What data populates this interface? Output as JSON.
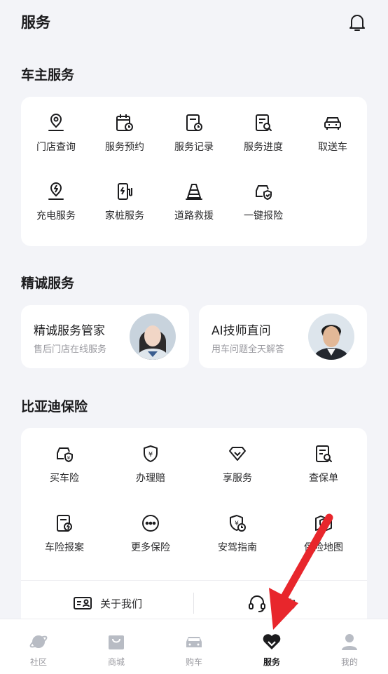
{
  "header": {
    "title": "服务",
    "bell_icon": "bell-icon"
  },
  "owner_services": {
    "title": "车主服务",
    "items": [
      {
        "label": "门店查询",
        "icon": "location-pin-icon"
      },
      {
        "label": "服务预约",
        "icon": "calendar-clock-icon"
      },
      {
        "label": "服务记录",
        "icon": "document-clock-icon"
      },
      {
        "label": "服务进度",
        "icon": "document-search-icon"
      },
      {
        "label": "取送车",
        "icon": "car-front-icon"
      },
      {
        "label": "充电服务",
        "icon": "charging-pin-icon"
      },
      {
        "label": "家桩服务",
        "icon": "charging-pile-icon"
      },
      {
        "label": "道路救援",
        "icon": "traffic-cone-icon"
      },
      {
        "label": "一键报险",
        "icon": "car-shield-icon"
      }
    ]
  },
  "sincere_services": {
    "title": "精诚服务",
    "cards": [
      {
        "title": "精诚服务管家",
        "subtitle": "售后门店在线服务",
        "avatar": "female-advisor-avatar"
      },
      {
        "title": "AI技师直问",
        "subtitle": "用车问题全天解答",
        "avatar": "male-technician-avatar"
      }
    ]
  },
  "insurance": {
    "title": "比亚迪保险",
    "items": [
      {
        "label": "买车险",
        "icon": "car-shield-yuan-icon"
      },
      {
        "label": "办理赔",
        "icon": "shield-yuan-icon"
      },
      {
        "label": "享服务",
        "icon": "diamond-icon"
      },
      {
        "label": "查保单",
        "icon": "policy-search-icon"
      },
      {
        "label": "车险报案",
        "icon": "report-bolt-icon"
      },
      {
        "label": "更多保险",
        "icon": "more-dots-icon"
      },
      {
        "label": "安驾指南",
        "icon": "shield-clock-icon"
      },
      {
        "label": "保险地图",
        "icon": "map-shield-icon"
      }
    ],
    "links": [
      {
        "label": "关于我们",
        "icon": "id-card-icon"
      },
      {
        "label": "咨询",
        "icon": "headset-icon"
      }
    ]
  },
  "tabbar": {
    "active": "服务",
    "tabs": [
      {
        "label": "社区",
        "icon": "planet-icon"
      },
      {
        "label": "商城",
        "icon": "shopping-bag-icon"
      },
      {
        "label": "购车",
        "icon": "car-icon"
      },
      {
        "label": "服务",
        "icon": "service-heart-icon"
      },
      {
        "label": "我的",
        "icon": "person-icon"
      }
    ]
  },
  "colors": {
    "accent_arrow": "#e8262c",
    "background": "#f3f4f8",
    "text_primary": "#1c1c1e",
    "text_secondary": "#9a9aa0"
  }
}
